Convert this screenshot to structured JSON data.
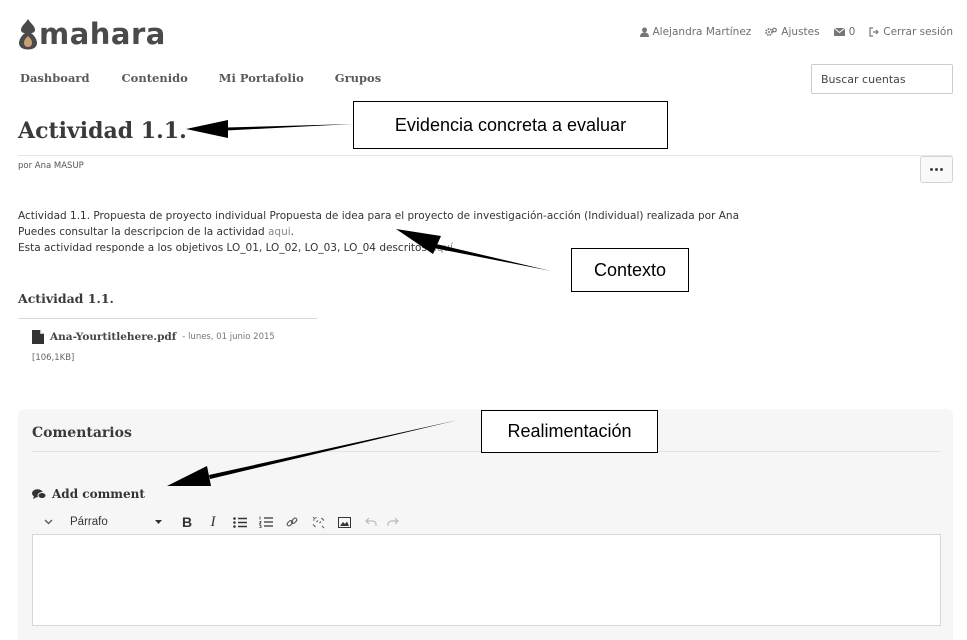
{
  "header": {
    "logo_text": "mahara",
    "user_name": "Alejandra Martínez",
    "settings_label": "Ajustes",
    "inbox_count": "0",
    "logout_label": "Cerrar sesión"
  },
  "nav": {
    "items": [
      {
        "label": "Dashboard"
      },
      {
        "label": "Contenido"
      },
      {
        "label": "Mi Portafolio"
      },
      {
        "label": "Grupos"
      }
    ],
    "search_placeholder": "Buscar cuentas"
  },
  "page": {
    "title": "Actividad 1.1.",
    "byline_prefix": "por ",
    "byline_author": "Ana MASUP"
  },
  "description": {
    "line1": "Actividad 1.1. Propuesta de proyecto individual Propuesta de idea para el proyecto de investigación-acción (Individual) realizada por Ana",
    "line2_text": "Puedes consultar la descripcion de la actividad ",
    "line2_link": "aqui",
    "line2_end": ".",
    "line3_text": "Esta actividad responde a los objetivos LO_01, LO_02, LO_03, LO_04 descritos ",
    "line3_link": "aquí",
    "line3_end": "."
  },
  "attachment_section": {
    "title": "Actividad 1.1.",
    "file_name": "Ana-Yourtitlehere.pdf",
    "file_date": "- lunes, 01 junio 2015",
    "file_size": "[106,1KB]"
  },
  "comments": {
    "title": "Comentarios",
    "add_comment_label": "Add comment",
    "format_select": "Párrafo"
  },
  "annotations": {
    "evidence": "Evidencia concreta a evaluar",
    "context": "Contexto",
    "feedback": "Realimentación"
  }
}
